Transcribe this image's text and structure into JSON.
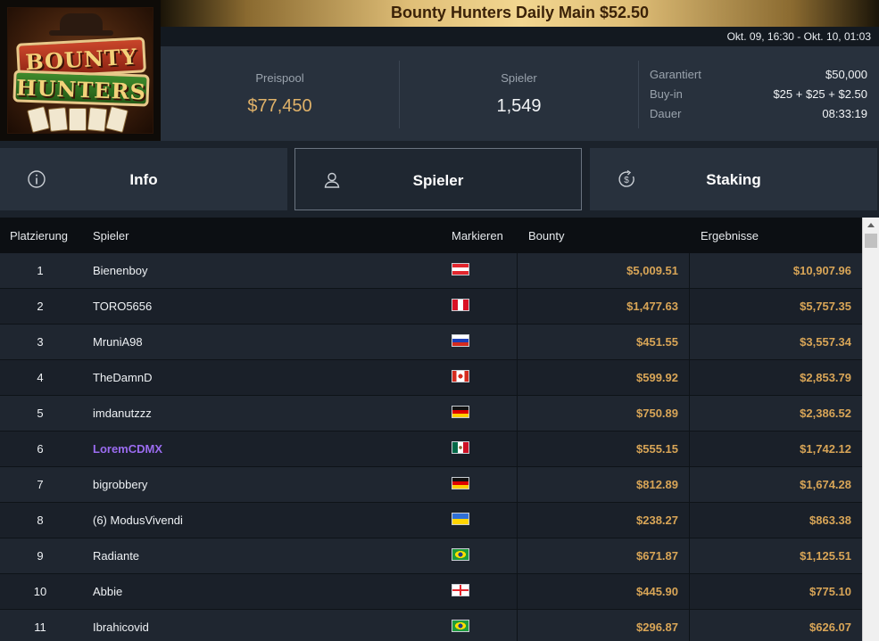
{
  "logo": {
    "line1": "BOUNTY",
    "line2": "HUNTERS"
  },
  "header": {
    "title": "Bounty Hunters Daily Main $52.50",
    "dates": "Okt. 09, 16:30 - Okt. 10, 01:03"
  },
  "stats": {
    "prizepool_label": "Preispool",
    "prizepool_value": "$77,450",
    "players_label": "Spieler",
    "players_value": "1,549",
    "details": [
      {
        "label": "Garantiert",
        "value": "$50,000"
      },
      {
        "label": "Buy-in",
        "value": "$25 + $25 + $2.50"
      },
      {
        "label": "Dauer",
        "value": "08:33:19"
      }
    ]
  },
  "tabs": [
    {
      "label": "Info",
      "icon": "info-icon"
    },
    {
      "label": "Spieler",
      "icon": "user-icon",
      "active": true
    },
    {
      "label": "Staking",
      "icon": "dollar-cycle-icon"
    }
  ],
  "table": {
    "columns": [
      "Platzierung",
      "Spieler",
      "Markieren",
      "Bounty",
      "Ergebnisse"
    ],
    "rows": [
      {
        "place": "1",
        "player": "Bienenboy",
        "flag": "AT",
        "bounty": "$5,009.51",
        "result": "$10,907.96"
      },
      {
        "place": "2",
        "player": "TORO5656",
        "flag": "PE",
        "bounty": "$1,477.63",
        "result": "$5,757.35"
      },
      {
        "place": "3",
        "player": "MruniA98",
        "flag": "RU",
        "bounty": "$451.55",
        "result": "$3,557.34"
      },
      {
        "place": "4",
        "player": "TheDamnD",
        "flag": "CA",
        "bounty": "$599.92",
        "result": "$2,853.79"
      },
      {
        "place": "5",
        "player": "imdanutzzz",
        "flag": "DE",
        "bounty": "$750.89",
        "result": "$2,386.52"
      },
      {
        "place": "6",
        "player": "LoremCDMX",
        "flag": "MX",
        "bounty": "$555.15",
        "result": "$1,742.12",
        "highlight": true
      },
      {
        "place": "7",
        "player": "bigrobbery",
        "flag": "DE",
        "bounty": "$812.89",
        "result": "$1,674.28"
      },
      {
        "place": "8",
        "player": "(6) ModusVivendi",
        "flag": "UA",
        "bounty": "$238.27",
        "result": "$863.38"
      },
      {
        "place": "9",
        "player": "Radiante",
        "flag": "BR",
        "bounty": "$671.87",
        "result": "$1,125.51"
      },
      {
        "place": "10",
        "player": "Abbie",
        "flag": "GE",
        "bounty": "$445.90",
        "result": "$775.10"
      },
      {
        "place": "11",
        "player": "Ibrahicovid",
        "flag": "BR",
        "bounty": "$296.87",
        "result": "$626.07"
      }
    ]
  },
  "colors": {
    "accent_gold": "#d8a557",
    "highlight_player": "#9b6cf0"
  }
}
